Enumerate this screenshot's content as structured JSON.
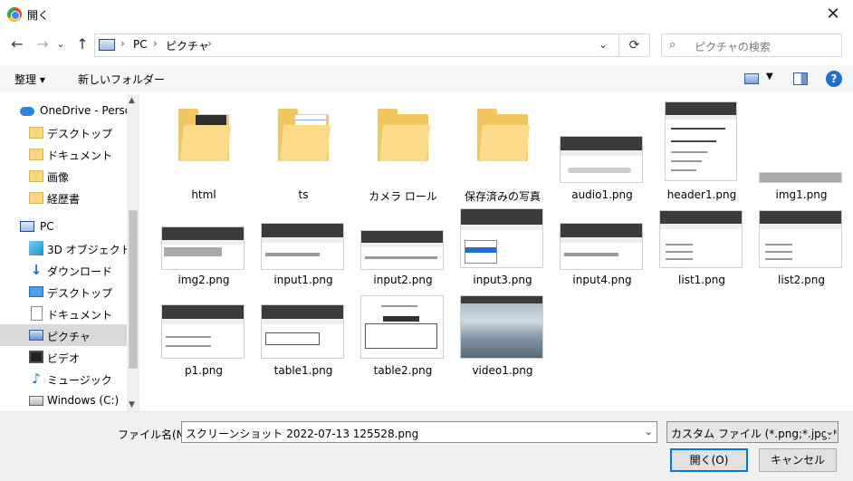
{
  "window": {
    "title": "開く",
    "close": "✕"
  },
  "nav": {
    "back": "←",
    "forward": "→",
    "recent": "⌄",
    "up": "↑",
    "crumbs": [
      "PC",
      "ピクチャ"
    ],
    "sep": "›",
    "dropdown": "⌄",
    "refresh": "⟳",
    "search_placeholder": "ピクチャの検索",
    "search_icon": "⌕"
  },
  "toolbar": {
    "organize": "整理 ▾",
    "new_folder": "新しいフォルダー",
    "view_dd": "▼",
    "help": "?"
  },
  "sidebar": {
    "items": [
      {
        "label": "OneDrive - Personal",
        "icon": "cloud"
      },
      {
        "label": "デスクトップ",
        "icon": "folder"
      },
      {
        "label": "ドキュメント",
        "icon": "folder"
      },
      {
        "label": "画像",
        "icon": "folder"
      },
      {
        "label": "経歴書",
        "icon": "folder"
      },
      {
        "label": "PC",
        "icon": "pc"
      },
      {
        "label": "3D オブジェクト",
        "icon": "cube"
      },
      {
        "label": "ダウンロード",
        "icon": "down"
      },
      {
        "label": "デスクトップ",
        "icon": "desk"
      },
      {
        "label": "ドキュメント",
        "icon": "doc"
      },
      {
        "label": "ピクチャ",
        "icon": "pic"
      },
      {
        "label": "ビデオ",
        "icon": "video"
      },
      {
        "label": "ミュージック",
        "icon": "music"
      },
      {
        "label": "Windows (C:)",
        "icon": "drive"
      }
    ],
    "scroll_up": "▲",
    "scroll_down": "▼"
  },
  "files": [
    {
      "name": "html",
      "kind": "folder"
    },
    {
      "name": "ts",
      "kind": "folder"
    },
    {
      "name": "カメラ ロール",
      "kind": "folder"
    },
    {
      "name": "保存済みの写真",
      "kind": "folder"
    },
    {
      "name": "audio1.png",
      "kind": "image"
    },
    {
      "name": "header1.png",
      "kind": "image"
    },
    {
      "name": "img1.png",
      "kind": "image"
    },
    {
      "name": "img2.png",
      "kind": "image"
    },
    {
      "name": "input1.png",
      "kind": "image"
    },
    {
      "name": "input2.png",
      "kind": "image"
    },
    {
      "name": "input3.png",
      "kind": "image"
    },
    {
      "name": "input4.png",
      "kind": "image"
    },
    {
      "name": "list1.png",
      "kind": "image"
    },
    {
      "name": "list2.png",
      "kind": "image"
    },
    {
      "name": "p1.png",
      "kind": "image"
    },
    {
      "name": "table1.png",
      "kind": "image"
    },
    {
      "name": "table2.png",
      "kind": "image"
    },
    {
      "name": "video1.png",
      "kind": "image"
    }
  ],
  "bottom": {
    "filename_label": "ファイル名(N):",
    "filename_value": "スクリーンショット 2022-07-13 125528.png",
    "filename_dd": "⌄",
    "filetype_value": "カスタム ファイル (*.png;*.jpg;*.jpeg)",
    "filetype_dd": "⌄",
    "open_button": "開く(O)",
    "cancel_button": "キャンセル"
  }
}
